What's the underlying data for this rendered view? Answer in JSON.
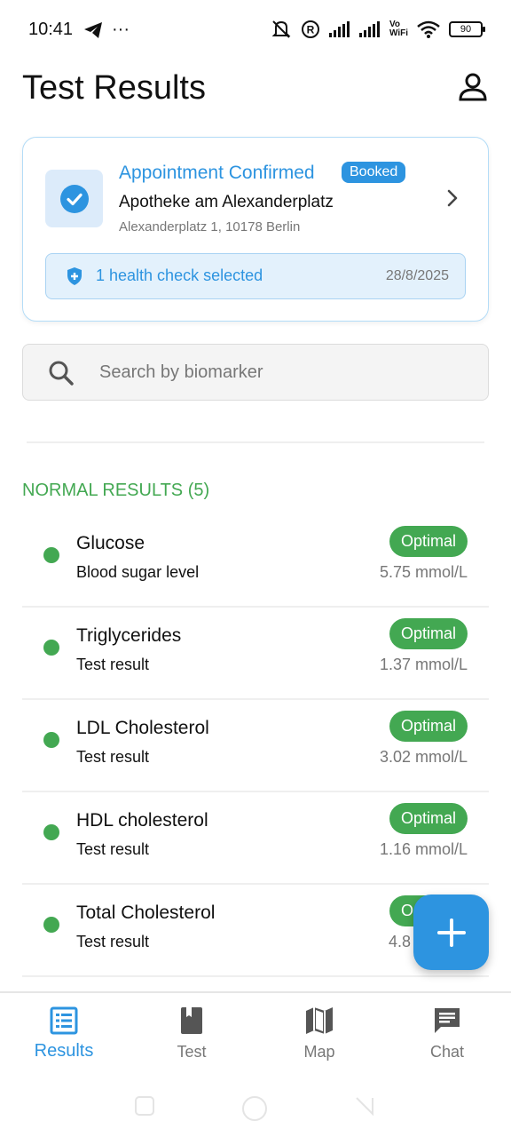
{
  "status_bar": {
    "time": "10:41",
    "dots": "···",
    "battery": "90",
    "vowifi": "Vo\nWiFi"
  },
  "header": {
    "title": "Test Results"
  },
  "appointment": {
    "title": "Appointment Confirmed",
    "badge": "Booked",
    "place": "Apotheke am Alexanderplatz",
    "address": "Alexanderplatz 1, 10178 Berlin",
    "health_check": "1 health check selected",
    "date": "28/8/2025"
  },
  "search": {
    "placeholder": "Search by biomarker",
    "value": ""
  },
  "section": {
    "title": "NORMAL RESULTS (5)"
  },
  "results": [
    {
      "name": "Glucose",
      "desc": "Blood sugar level",
      "status": "Optimal",
      "value": "5.75 mmol/L"
    },
    {
      "name": "Triglycerides",
      "desc": "Test result",
      "status": "Optimal",
      "value": "1.37 mmol/L"
    },
    {
      "name": "LDL Cholesterol",
      "desc": "Test result",
      "status": "Optimal",
      "value": "3.02 mmol/L"
    },
    {
      "name": "HDL cholesterol",
      "desc": "Test result",
      "status": "Optimal",
      "value": "1.16 mmol/L"
    },
    {
      "name": "Total Cholesterol",
      "desc": "Test result",
      "status": "Optimal",
      "value": "4.8 mmol/L"
    }
  ],
  "nav": {
    "items": [
      {
        "label": "Results",
        "icon": "list-icon"
      },
      {
        "label": "Test",
        "icon": "book-icon"
      },
      {
        "label": "Map",
        "icon": "map-icon"
      },
      {
        "label": "Chat",
        "icon": "chat-icon"
      }
    ]
  },
  "colors": {
    "accent": "#2d94e0",
    "success": "#43a852",
    "muted": "#777777"
  }
}
